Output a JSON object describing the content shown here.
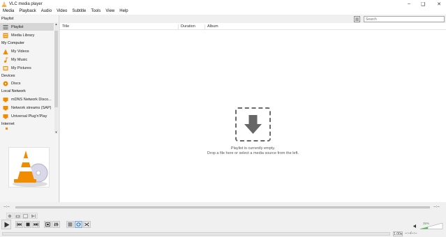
{
  "window": {
    "title": "VLC media player"
  },
  "menu": [
    "Media",
    "Playback",
    "Audio",
    "Video",
    "Subtitle",
    "Tools",
    "View",
    "Help"
  ],
  "sidebar": {
    "sections": [
      {
        "label": "Playlist",
        "items": [
          {
            "label": "Playlist",
            "icon": "playlist-icon",
            "active": true
          },
          {
            "label": "Media Library",
            "icon": "media-library-icon"
          }
        ]
      },
      {
        "label": "My Computer",
        "items": [
          {
            "label": "My Videos",
            "icon": "video-folder-icon"
          },
          {
            "label": "My Music",
            "icon": "music-note-icon"
          },
          {
            "label": "My Pictures",
            "icon": "pictures-icon"
          }
        ]
      },
      {
        "label": "Devices",
        "items": [
          {
            "label": "Discs",
            "icon": "disc-icon"
          }
        ]
      },
      {
        "label": "Local Network",
        "items": [
          {
            "label": "mDNS Network Disco...",
            "icon": "network-icon"
          },
          {
            "label": "Network streams (SAP)",
            "icon": "network-icon"
          },
          {
            "label": "Universal Plug'n'Play",
            "icon": "network-icon"
          }
        ]
      },
      {
        "label": "Internet",
        "items": []
      }
    ]
  },
  "playlist": {
    "search_placeholder": "Search",
    "columns": [
      "Title",
      "Duration",
      "Album"
    ],
    "empty_line1": "Playlist is currently empty.",
    "empty_line2": "Drop a file here or select a media source from the left."
  },
  "seek": {
    "elapsed": "--:--",
    "total": "--:--"
  },
  "status": {
    "speed": "1.00x",
    "time": "--:--/--:--"
  },
  "volume": {
    "percent_label": "35%",
    "level": 0.35
  },
  "colors": {
    "accent_orange": "#f08c00",
    "volume_green": "#5bb85b",
    "active_item": "#d6d6d6"
  }
}
